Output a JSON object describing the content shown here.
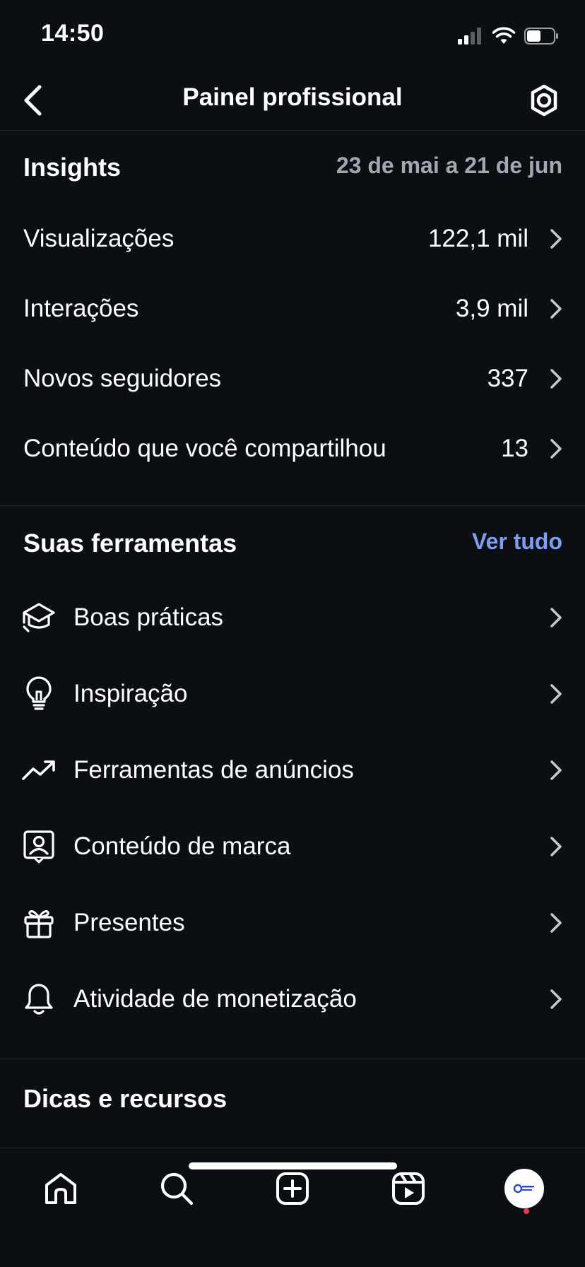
{
  "status_bar": {
    "time": "14:50"
  },
  "header": {
    "title": "Painel profissional"
  },
  "insights": {
    "title": "Insights",
    "date_range": "23 de mai a 21 de jun",
    "metrics": [
      {
        "label": "Visualizações",
        "value": "122,1 mil"
      },
      {
        "label": "Interações",
        "value": "3,9 mil"
      },
      {
        "label": "Novos seguidores",
        "value": "337"
      },
      {
        "label": "Conteúdo que você compartilhou",
        "value": "13"
      }
    ]
  },
  "tools": {
    "title": "Suas ferramentas",
    "see_all": "Ver tudo",
    "items": [
      {
        "label": "Boas práticas",
        "icon": "graduation-cap-icon"
      },
      {
        "label": "Inspiração",
        "icon": "lightbulb-icon"
      },
      {
        "label": "Ferramentas de anúncios",
        "icon": "trending-up-icon"
      },
      {
        "label": "Conteúdo de marca",
        "icon": "branded-content-icon"
      },
      {
        "label": "Presentes",
        "icon": "gift-icon"
      },
      {
        "label": "Atividade de monetização",
        "icon": "bell-icon"
      }
    ]
  },
  "tips": {
    "title": "Dicas e recursos"
  },
  "bottom_nav": {
    "items": [
      "home-icon",
      "search-icon",
      "create-icon",
      "reels-icon",
      "profile-avatar"
    ]
  },
  "colors": {
    "background": "#0b0e13",
    "text": "#ffffff",
    "muted": "#a3a8b0",
    "accent": "#7e9ef0",
    "notification": "#ff3040"
  }
}
